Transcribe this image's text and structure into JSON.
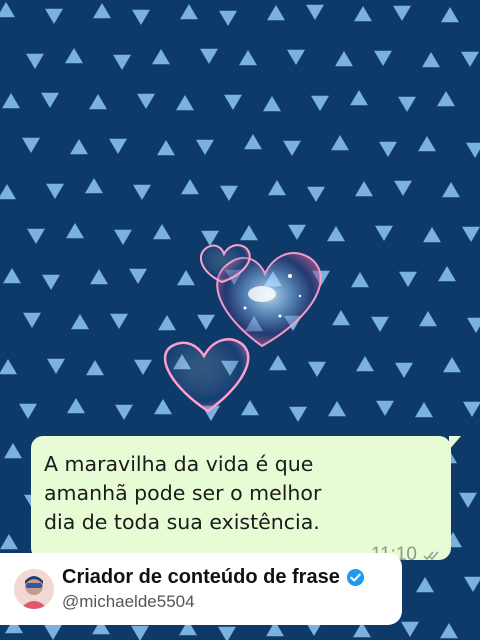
{
  "background": {
    "color": "#0e3a6a",
    "pattern_color": "#7ab1dd",
    "pattern": "triangles"
  },
  "message": {
    "text": "A maravilha da vida é que\namanhã pode ser o melhor\ndia de toda sua existência.",
    "time": "11:10",
    "status_icon": "double-check-icon",
    "bubble_color": "#e7fbd5"
  },
  "profile": {
    "name": "Criador de conteúdo de frase",
    "handle": "@michaelde5504",
    "verified_icon": "verified-badge-icon",
    "accent": "#1d9bf0"
  }
}
